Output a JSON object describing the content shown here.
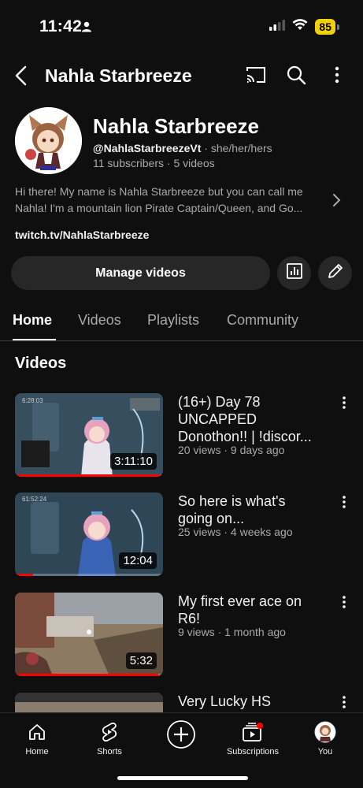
{
  "status": {
    "time": "11:42",
    "battery": "85"
  },
  "header": {
    "title": "Nahla Starbreeze"
  },
  "channel": {
    "name": "Nahla Starbreeze",
    "handle": "@NahlaStarbreezeVt",
    "pronouns": "she/her/hers",
    "subscribers": "11 subscribers",
    "videos_count": "5 videos",
    "description_line1": "Hi there! My name is Nahla Starbreeze but you can call me",
    "description_line2": "Nahla! I'm a mountain lion Pirate Captain/Queen, and Go...",
    "link": "twitch.tv/NahlaStarbreeze"
  },
  "actions": {
    "manage_label": "Manage videos"
  },
  "tabs": [
    {
      "label": "Home",
      "active": true
    },
    {
      "label": "Videos"
    },
    {
      "label": "Playlists"
    },
    {
      "label": "Community"
    }
  ],
  "section_title": "Videos",
  "videos": [
    {
      "title_line1": "(16+) Day 78",
      "title_line2": "UNCAPPED",
      "title_line3": "Donothon!! | !discor...",
      "meta": "20 views · 9 days ago",
      "duration": "3:11:10",
      "thumb_timestamp": "6:28:03",
      "progress": 0.98
    },
    {
      "title_line1": "So here is what's",
      "title_line2": "going on...",
      "title_line3": "",
      "meta": "25 views · 4 weeks ago",
      "duration": "12:04",
      "thumb_timestamp": "61:52:24",
      "progress": 0.12
    },
    {
      "title_line1": "My first ever ace on",
      "title_line2": "R6!",
      "title_line3": "",
      "meta": "9 views · 1 month ago",
      "duration": "5:32",
      "thumb_timestamp": "",
      "progress": 0.97
    },
    {
      "title_line1": "Very Lucky HS",
      "title_line2": "",
      "title_line3": "",
      "meta": "",
      "duration": "",
      "thumb_timestamp": "",
      "progress": 0
    }
  ],
  "bottom_nav": [
    {
      "label": "Home"
    },
    {
      "label": "Shorts"
    },
    {
      "label": ""
    },
    {
      "label": "Subscriptions"
    },
    {
      "label": "You"
    }
  ],
  "colors": {
    "accent": "#ff0000",
    "battery": "#f2d10a",
    "background": "#0f0f0f",
    "chip": "#272727"
  }
}
